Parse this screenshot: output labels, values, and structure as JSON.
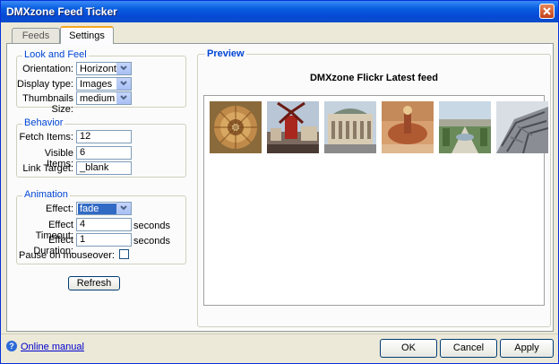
{
  "window": {
    "title": "DMXzone Feed Ticker"
  },
  "tabs": [
    {
      "label": "Feeds",
      "active": false
    },
    {
      "label": "Settings",
      "active": true
    }
  ],
  "look_and_feel": {
    "legend": "Look and Feel",
    "orientation": {
      "label": "Orientation:",
      "value": "Horizontal"
    },
    "display_type": {
      "label": "Display type:",
      "value": "Images"
    },
    "thumbnails_size": {
      "label": "Thumbnails Size:",
      "value": "medium"
    }
  },
  "behavior": {
    "legend": "Behavior",
    "fetch_items": {
      "label": "Fetch Items:",
      "value": "12"
    },
    "visible_items": {
      "label": "Visible Items:",
      "value": "6"
    },
    "link_target": {
      "label": "Link Target:",
      "value": "_blank"
    }
  },
  "animation": {
    "legend": "Animation",
    "effect": {
      "label": "Effect:",
      "value": "fade"
    },
    "effect_timeout": {
      "label": "Effect Timeout:",
      "value": "4",
      "unit": "seconds"
    },
    "effect_duration": {
      "label": "Effect Duration:",
      "value": "1",
      "unit": "seconds"
    },
    "pause_on_mouseover": {
      "label": "Pause on mouseover:",
      "checked": false
    }
  },
  "refresh_label": "Refresh",
  "preview": {
    "title": "Preview",
    "feed_title": "DMXzone Flickr Latest feed",
    "thumbnails": [
      "dome-ceiling",
      "moulin-rouge",
      "opera-facade",
      "fountain-square",
      "palace-gardens",
      "tower-angle"
    ]
  },
  "footer": {
    "manual_label": "Online manual",
    "ok_label": "OK",
    "cancel_label": "Cancel",
    "apply_label": "Apply"
  },
  "colors": {
    "titlebar": "#0549d6",
    "legend": "#0046d5",
    "link": "#0000cc"
  }
}
